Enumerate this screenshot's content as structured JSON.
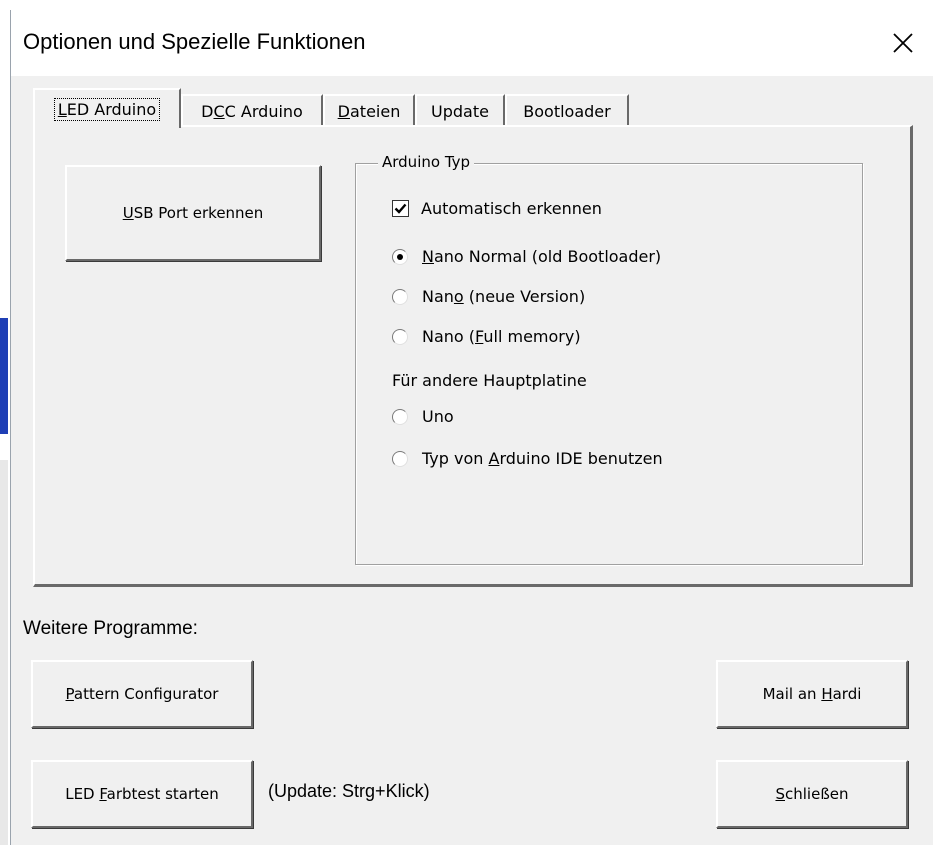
{
  "window": {
    "title": "Optionen und Spezielle Funktionen",
    "close_label": "×"
  },
  "tabs": [
    {
      "pre": "",
      "ul": "L",
      "post": "ED Arduino",
      "active": true
    },
    {
      "pre": "D",
      "ul": "C",
      "post": "C Arduino",
      "active": false
    },
    {
      "pre": "",
      "ul": "D",
      "post": "ateien",
      "active": false
    },
    {
      "pre": "Update",
      "ul": "",
      "post": "",
      "active": false
    },
    {
      "pre": "Bootloader",
      "ul": "",
      "post": "",
      "active": false
    }
  ],
  "panel": {
    "usb_button": {
      "pre": "",
      "ul": "U",
      "post": "SB Port erkennen"
    },
    "group_title": "Arduino Typ",
    "auto_detect": {
      "label": "Automatisch erkennen",
      "checked": true
    },
    "radios": [
      {
        "pre": "",
        "ul": "N",
        "post": "ano Normal (old Bootloader)",
        "checked": true
      },
      {
        "pre": "Nan",
        "ul": "o",
        "post": " (neue Version)",
        "checked": false
      },
      {
        "pre": "Nano (",
        "ul": "F",
        "post": "ull memory)",
        "checked": false
      }
    ],
    "other_heading": "Für andere Hauptplatine",
    "other_radios": [
      {
        "pre": "Uno",
        "ul": "",
        "post": "",
        "checked": false
      },
      {
        "pre": "Typ von ",
        "ul": "A",
        "post": "rduino IDE benutzen",
        "checked": false
      }
    ]
  },
  "footer": {
    "weitere_label": "Weitere Programme:",
    "pattern_button": {
      "pre": "",
      "ul": "P",
      "post": "attern Configurator"
    },
    "mail_button": {
      "pre": "Mail an ",
      "ul": "H",
      "post": "ardi"
    },
    "farbtest_button": {
      "pre": "LED ",
      "ul": "F",
      "post": "arbtest starten"
    },
    "update_hint": "(Update: Strg+Klick)",
    "close_button": {
      "pre": "",
      "ul": "S",
      "post": "chließen"
    }
  }
}
